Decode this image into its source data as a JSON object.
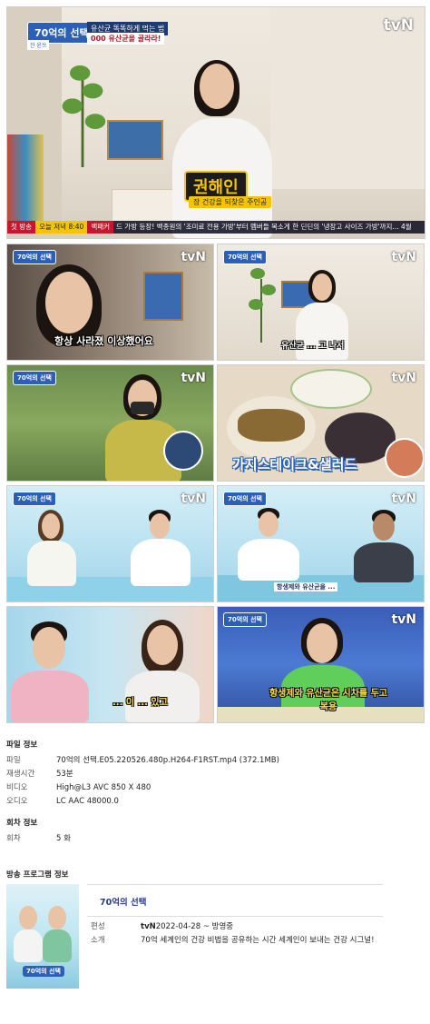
{
  "main_frame": {
    "logo": "tvN",
    "show_badge": "70억의 선택",
    "sub_badge": "잔 윤쓰",
    "caption_line1": "유산균 똑똑하게 먹는 법",
    "caption_line2": "000 유산균을 골라라!",
    "name_card": "권해인",
    "name_sub": "장 건강을 되찾은 주인공",
    "ticker": {
      "now": "첫 방송",
      "time": "오늘 저녁 8:40",
      "program": "백패커",
      "text": "드 가방 등장! 백종원의 '조미료 전용 가방'부터 멤버들 목소게 한 딘딘의 '냉장고 사이즈 가방'까지... 4월"
    }
  },
  "thumbnails": [
    {
      "logo": "tvN",
      "badge": "70억의 선택",
      "subtitle": "항상 사라졌 이상했어요"
    },
    {
      "logo": "tvN",
      "badge": "70억의 선택",
      "subtitle": "유산균 ... 고 나서"
    },
    {
      "logo": "tvN",
      "badge": "70억의 선택",
      "subtitle": ""
    },
    {
      "logo": "tvN",
      "badge": "",
      "subtitle": "가지스테이크&샐러드"
    },
    {
      "logo": "tvN",
      "badge": "70억의 선택",
      "subtitle": ""
    },
    {
      "logo": "tvN",
      "badge": "70억의 선택",
      "subtitle": "항생제와 유산균을 ..."
    },
    {
      "logo": "",
      "badge": "",
      "subtitle": "... 이 ... 있고"
    },
    {
      "logo": "tvN",
      "badge": "70억의 선택",
      "subtitle": "항생제와 유산균은 시차를 두고 복용"
    }
  ],
  "file_info": {
    "title": "파일 정보",
    "rows": [
      {
        "key": "파일",
        "value": "70억의 선택.E05.220526.480p.H264-F1RST.mp4 (372.1MB)"
      },
      {
        "key": "재생시간",
        "value": "53분"
      },
      {
        "key": "비디오",
        "value": "High@L3 AVC 850 X 480"
      },
      {
        "key": "오디오",
        "value": "LC AAC 48000.0"
      }
    ]
  },
  "episode_info": {
    "title": "회차 정보",
    "rows": [
      {
        "key": "회차",
        "value": "5 화"
      }
    ]
  },
  "program_info": {
    "title": "방송 프로그램 정보",
    "program_name": "70억의 선택",
    "poster_title": "70억의 선택",
    "rows": [
      {
        "key": "편성",
        "channel": "tvN",
        "value": " 2022-04-28 ~ 방영중"
      },
      {
        "key": "소개",
        "channel": "",
        "value": "70억 세계인의 건강 비법을 공유하는 시간 세계인이 보내는 건강 시그널!"
      }
    ]
  },
  "colors": {
    "accent": "#2b5fb8",
    "highlight": "#f4c400",
    "ticker_red": "#c7172e"
  }
}
